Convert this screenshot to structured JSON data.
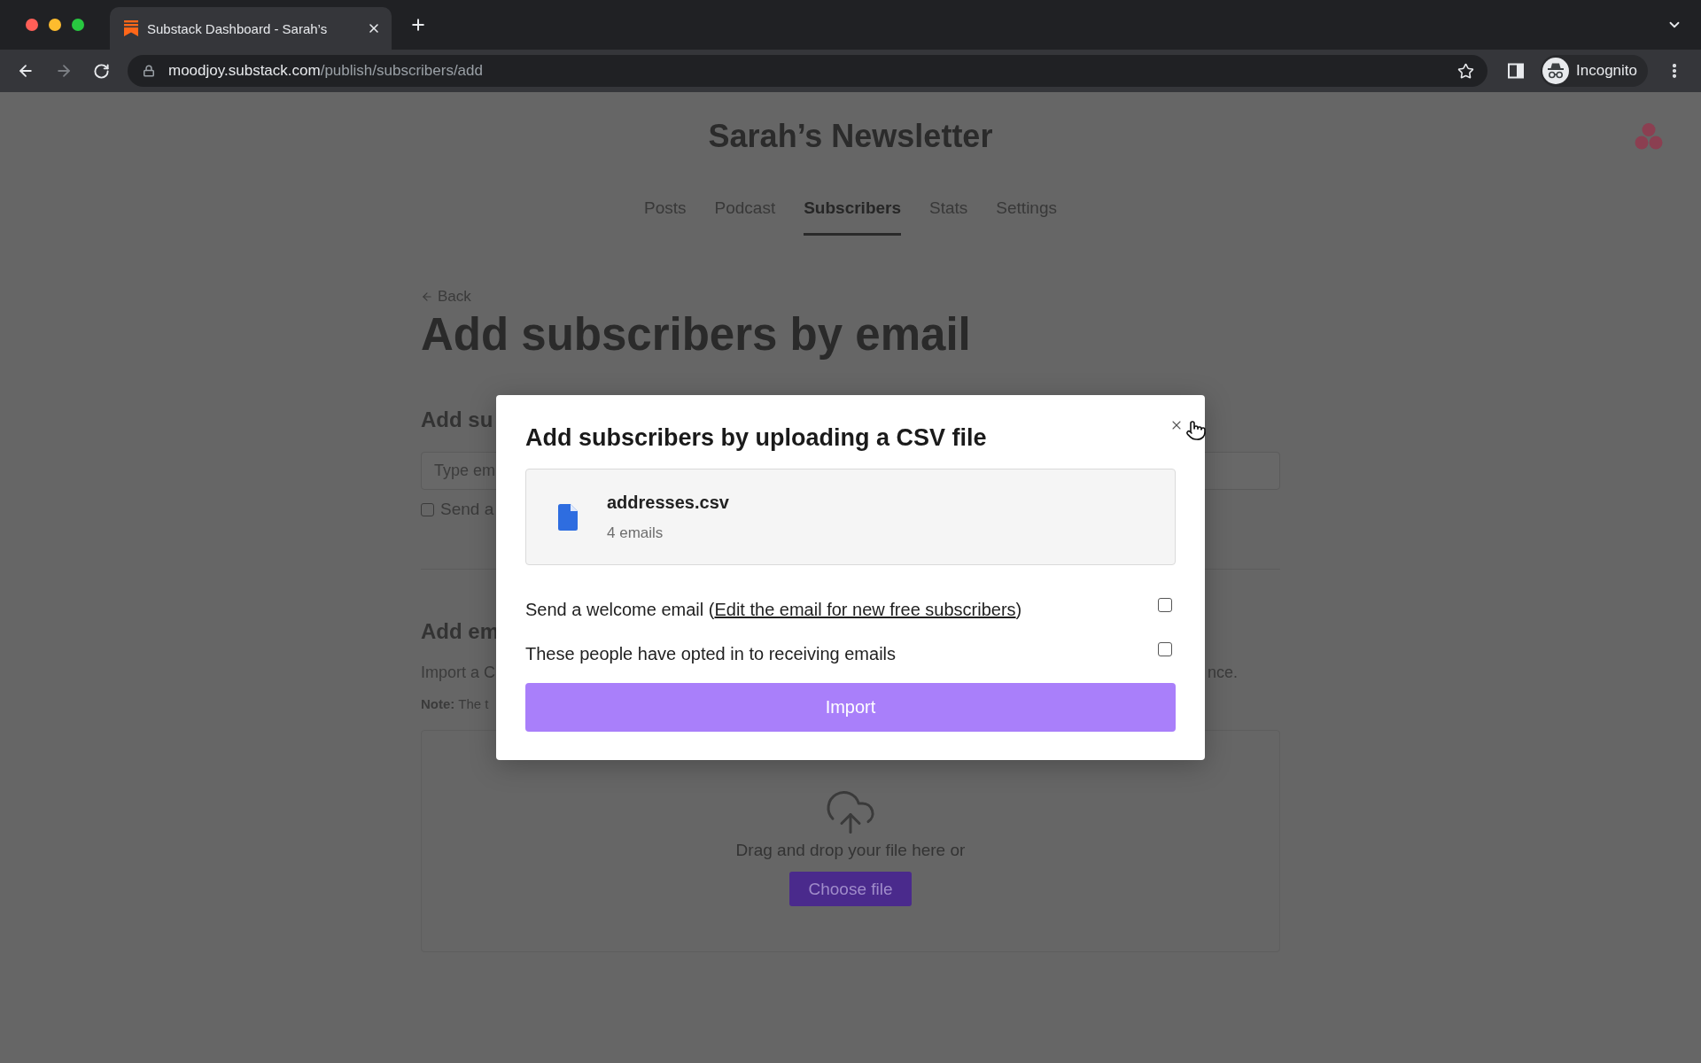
{
  "browser": {
    "tab": {
      "title": "Substack Dashboard - Sarah’s",
      "selected": true
    },
    "url": {
      "host": "moodjoy.substack.com",
      "path": "/publish/subscribers/add"
    },
    "profile": "Incognito"
  },
  "header": {
    "title": "Sarah’s Newsletter"
  },
  "nav": [
    {
      "label": "Posts",
      "selected": false
    },
    {
      "label": "Podcast",
      "selected": false
    },
    {
      "label": "Subscribers",
      "selected": true
    },
    {
      "label": "Stats",
      "selected": false
    },
    {
      "label": "Settings",
      "selected": false
    }
  ],
  "page": {
    "back": "Back",
    "title": "Add subscribers by email",
    "single_section": {
      "heading": "Add su",
      "input": {
        "placeholder": "Type em"
      },
      "checkbox": {
        "label": "Send a",
        "checked": false
      }
    },
    "import_section": {
      "heading": "Add em",
      "description_start": "Import a C",
      "description_end": "nce.",
      "note": "**Note:** The t",
      "dropzone": {
        "text": "Drag and drop your file here or",
        "button": "Choose file"
      }
    }
  },
  "modal": {
    "title": "Add subscribers by uploading a CSV file",
    "file": {
      "name": "addresses.csv",
      "count": "4 emails"
    },
    "options": [
      {
        "text": "Send a welcome email (",
        "link": "Edit the email for new free subscribers",
        "text_after": ")",
        "checked": false
      },
      {
        "text": "These people have opted in to receiving emails",
        "checked": false
      }
    ],
    "button": "Import"
  }
}
